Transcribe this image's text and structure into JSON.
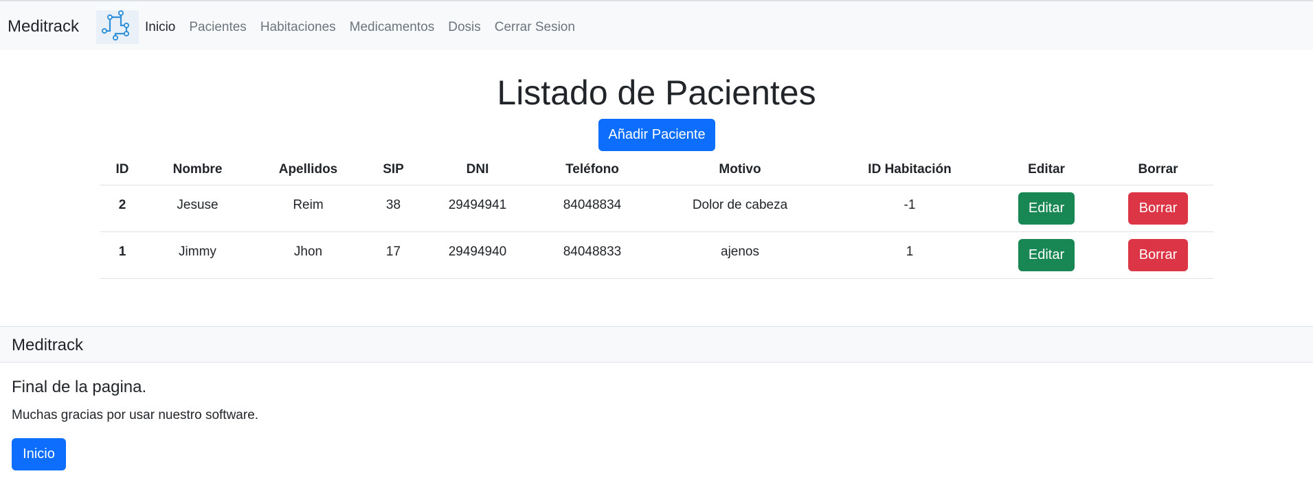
{
  "navbar": {
    "brand": "Meditrack",
    "logo_icon": "circuit-logo-icon",
    "items": [
      {
        "label": "Inicio",
        "active": true
      },
      {
        "label": "Pacientes",
        "active": false
      },
      {
        "label": "Habitaciones",
        "active": false
      },
      {
        "label": "Medicamentos",
        "active": false
      },
      {
        "label": "Dosis",
        "active": false
      },
      {
        "label": "Cerrar Sesion",
        "active": false
      }
    ]
  },
  "main": {
    "title": "Listado de Pacientes",
    "add_button": "Añadir Paciente",
    "table": {
      "headers": [
        "ID",
        "Nombre",
        "Apellidos",
        "SIP",
        "DNI",
        "Teléfono",
        "Motivo",
        "ID Habitación",
        "Editar",
        "Borrar"
      ],
      "rows": [
        {
          "id": "2",
          "nombre": "Jesuse",
          "apellidos": "Reim",
          "sip": "38",
          "dni": "29494941",
          "telefono": "84048834",
          "motivo": "Dolor de cabeza",
          "id_habitacion": "-1",
          "edit_label": "Editar",
          "delete_label": "Borrar"
        },
        {
          "id": "1",
          "nombre": "Jimmy",
          "apellidos": "Jhon",
          "sip": "17",
          "dni": "29494940",
          "telefono": "84048833",
          "motivo": "ajenos",
          "id_habitacion": "1",
          "edit_label": "Editar",
          "delete_label": "Borrar"
        }
      ]
    }
  },
  "footer": {
    "brand": "Meditrack",
    "title": "Final de la pagina.",
    "text": "Muchas gracias por usar nuestro software.",
    "button": "Inicio"
  },
  "colors": {
    "primary": "#0d6efd",
    "success": "#198754",
    "danger": "#dc3545",
    "navbar_bg": "#f8f9fa"
  }
}
